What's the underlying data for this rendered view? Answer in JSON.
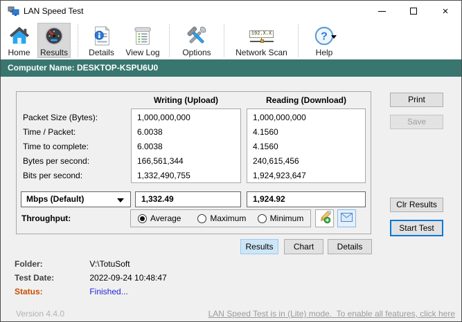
{
  "colors": {
    "header_bar": "#38766f",
    "accent_blue": "#0078d7",
    "status_label": "#c85000",
    "status_value": "#2222d6",
    "selected_tab_bg": "#cde6f7",
    "footer_link": "#9b9b9b"
  },
  "window": {
    "title": "LAN Speed Test",
    "close_glyph": "×"
  },
  "toolbar": {
    "items": [
      {
        "label": "Home",
        "icon": "home-icon"
      },
      {
        "label": "Results",
        "icon": "speedometer-icon",
        "selected": true
      },
      {
        "label": "Details",
        "icon": "document-info-icon"
      },
      {
        "label": "View Log",
        "icon": "log-scroll-icon"
      },
      {
        "label": "Options",
        "icon": "tools-icon"
      },
      {
        "label": "Network Scan",
        "icon": "network-node-icon",
        "badge": "192.X.X"
      },
      {
        "label": "Help",
        "icon": "question-icon"
      }
    ]
  },
  "computer_bar": {
    "text": "Computer Name: DESKTOP-KSPU6U0"
  },
  "results_panel": {
    "columns": {
      "writing": "Writing (Upload)",
      "reading": "Reading (Download)"
    },
    "rows": [
      {
        "label": "Packet Size (Bytes):",
        "writing": "1,000,000,000",
        "reading": "1,000,000,000"
      },
      {
        "label": "Time / Packet:",
        "writing": "6.0038",
        "reading": "4.1560"
      },
      {
        "label": "Time to complete:",
        "writing": "6.0038",
        "reading": "4.1560"
      },
      {
        "label": "Bytes per second:",
        "writing": "166,561,344",
        "reading": "240,615,456"
      },
      {
        "label": "Bits per second:",
        "writing": "1,332,490,755",
        "reading": "1,924,923,647"
      }
    ],
    "units_dropdown": {
      "selected": "Mbps (Default)"
    },
    "unit_values": {
      "writing": "1,332.49",
      "reading": "1,924.92"
    },
    "throughput": {
      "label": "Throughput:",
      "options": [
        "Average",
        "Maximum",
        "Minimum"
      ],
      "selected": "Average"
    }
  },
  "tabs": {
    "results": "Results",
    "chart": "Chart",
    "details": "Details"
  },
  "side_buttons": {
    "print": "Print",
    "save": "Save",
    "clr": "Clr Results",
    "start": "Start Test"
  },
  "info": {
    "folder_label": "Folder:",
    "folder_value": "V:\\TotuSoft",
    "date_label": "Test Date:",
    "date_value": "2022-09-24 10:48:47",
    "status_label": "Status:",
    "status_value": "Finished..."
  },
  "footer": {
    "version": "Version 4.4.0",
    "lite_notice": "LAN Speed Test is in (Lite) mode.  To enable all features, click here"
  }
}
